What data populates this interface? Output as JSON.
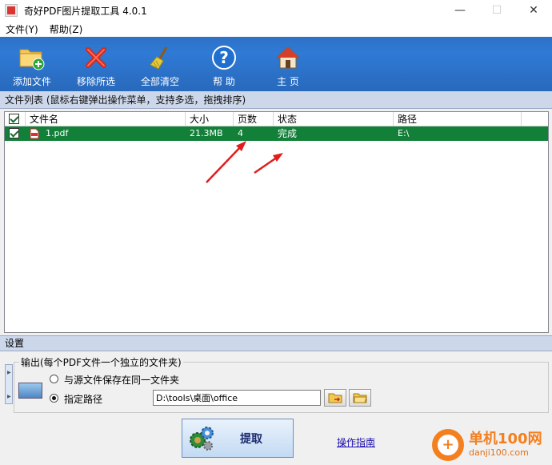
{
  "window": {
    "title": "奇好PDF图片提取工具 4.0.1"
  },
  "menu": [
    {
      "label": "文件(Y)"
    },
    {
      "label": "帮助(Z)"
    }
  ],
  "toolbar": [
    {
      "label": "添加文件",
      "icon": "add-folder-icon"
    },
    {
      "label": "移除所选",
      "icon": "remove-x-icon"
    },
    {
      "label": "全部清空",
      "icon": "broom-icon"
    },
    {
      "label": "帮 助",
      "icon": "help-icon"
    },
    {
      "label": "主 页",
      "icon": "home-icon"
    }
  ],
  "file_list": {
    "header": "文件列表  (鼠标右键弹出操作菜单，支持多选，拖拽排序)",
    "columns": [
      "文件名",
      "大小",
      "页数",
      "状态",
      "路径"
    ],
    "rows": [
      {
        "checked": true,
        "name": "1.pdf",
        "size": "21.3MB",
        "pages": "4",
        "status": "完成",
        "path": "E:\\"
      }
    ]
  },
  "settings": {
    "header": "设置",
    "output_legend": "输出(每个PDF文件一个独立的文件夹)",
    "options": [
      {
        "label": "与源文件保存在同一文件夹",
        "selected": false
      },
      {
        "label": "指定路径",
        "selected": true
      }
    ],
    "path_value": "D:\\tools\\桌面\\office"
  },
  "actions": {
    "extract_label": "提取",
    "guide_label": "操作指南"
  },
  "watermark": {
    "line1": "单机100网",
    "line2": "danji100.com"
  },
  "colors": {
    "toolbar_blue": "#2d71c6",
    "row_green": "#13803a",
    "header_bar": "#ccd7ea"
  }
}
